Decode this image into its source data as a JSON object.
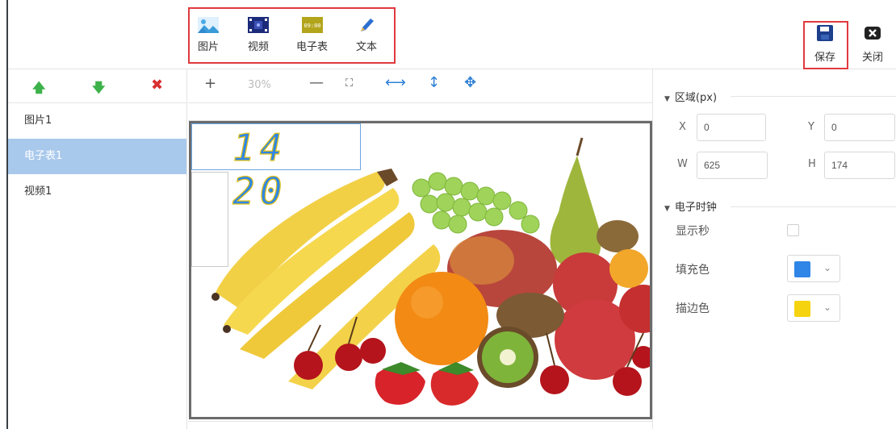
{
  "toolbar": {
    "items": [
      {
        "label": "图片",
        "icon": "image-icon"
      },
      {
        "label": "视频",
        "icon": "video-icon"
      },
      {
        "label": "电子表",
        "icon": "digital-clock-icon",
        "icon_text": "09:00"
      },
      {
        "label": "文本",
        "icon": "pencil-icon"
      }
    ],
    "save_label": "保存",
    "close_label": "关闭"
  },
  "layers": {
    "actions": [
      {
        "icon": "arrow-up-icon",
        "glyph": "🡅"
      },
      {
        "icon": "arrow-down-icon",
        "glyph": "🡇"
      },
      {
        "icon": "delete-icon",
        "glyph": "✖"
      }
    ],
    "items": [
      {
        "label": "图片1",
        "active": false
      },
      {
        "label": "电子表1",
        "active": true
      },
      {
        "label": "视频1",
        "active": false
      }
    ]
  },
  "canvas_toolbar": {
    "zoom_in": "+",
    "zoom_value": "30%",
    "zoom_out": "—",
    "fit_glyph": "⛶",
    "hfit_glyph": "⟷",
    "vfit_glyph": "↕",
    "move_glyph": "✥"
  },
  "canvas": {
    "clock_text": "14 20",
    "clock_fill_color": "#2f86e6",
    "clock_stroke_color": "#e0c21a",
    "image_subject": "fruit-photo"
  },
  "properties": {
    "region_title": "区域(px)",
    "x_label": "X",
    "x_value": "0",
    "y_label": "Y",
    "y_value": "0",
    "w_label": "W",
    "w_value": "625",
    "h_label": "H",
    "h_value": "174",
    "clock_section_title": "电子时钟",
    "show_seconds_label": "显示秒",
    "show_seconds": false,
    "fill_color_label": "填充色",
    "fill_color": "#2f86e6",
    "stroke_color_label": "描边色",
    "stroke_color": "#f5d30f"
  },
  "colors": {
    "highlight_border": "#e0393e",
    "active_layer": "#a9c9ec",
    "accent_blue": "#2d7fd6"
  }
}
